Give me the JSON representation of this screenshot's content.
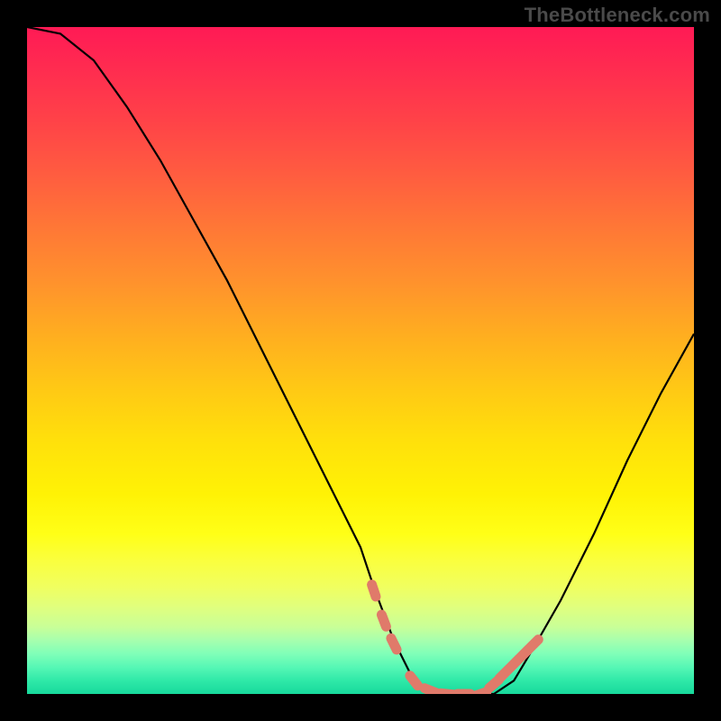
{
  "watermark": "TheBottleneck.com",
  "chart_data": {
    "type": "line",
    "title": "",
    "xlabel": "",
    "ylabel": "",
    "xlim": [
      0,
      100
    ],
    "ylim": [
      0,
      100
    ],
    "series": [
      {
        "name": "curve",
        "x": [
          0,
          5,
          10,
          15,
          20,
          25,
          30,
          35,
          40,
          45,
          50,
          52,
          55,
          58,
          61,
          64,
          67,
          70,
          73,
          76,
          80,
          85,
          90,
          95,
          100
        ],
        "y": [
          100,
          99,
          95,
          88,
          80,
          71,
          62,
          52,
          42,
          32,
          22,
          16,
          8,
          2,
          0,
          0,
          0,
          0,
          2,
          7,
          14,
          24,
          35,
          45,
          54
        ],
        "color": "#000000"
      },
      {
        "name": "highlight-dots",
        "x": [
          52,
          53.5,
          55,
          58,
          60.5,
          63,
          65.5,
          68,
          70,
          71.5,
          73,
          74.5,
          76
        ],
        "y": [
          15.5,
          11,
          7.5,
          2,
          0.5,
          0,
          0,
          0,
          1.5,
          3,
          4.5,
          6,
          7.5
        ],
        "color": "#e07a6a"
      }
    ],
    "gradient_colors": {
      "top": "#ff1a55",
      "mid": "#ffe00b",
      "bottom": "#17d99c"
    }
  }
}
